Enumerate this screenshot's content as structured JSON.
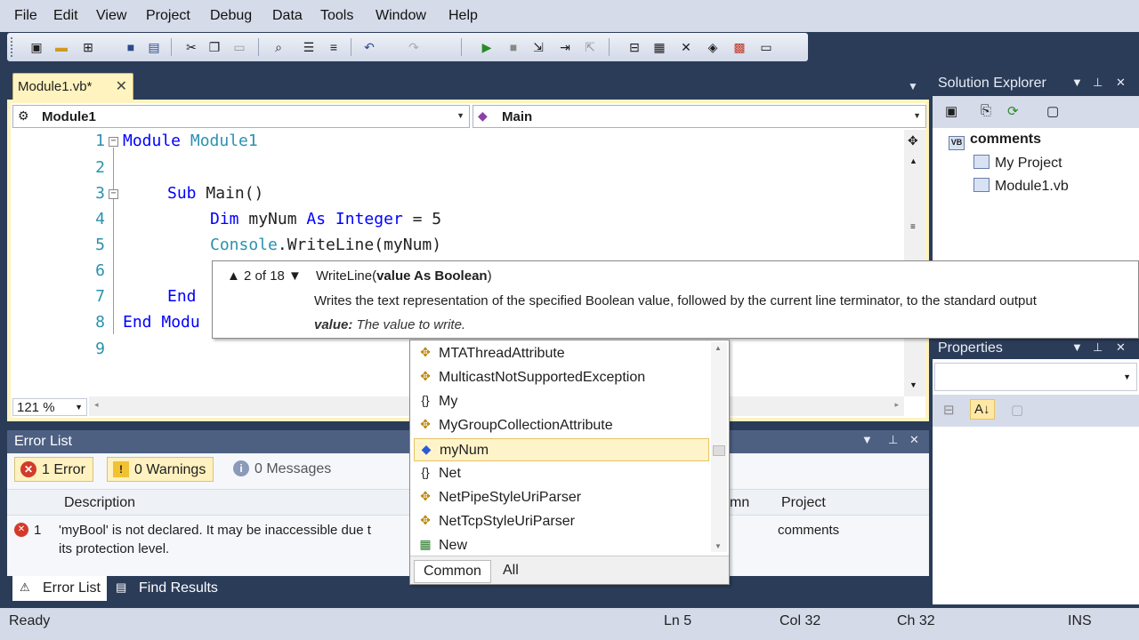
{
  "menu": [
    "File",
    "Edit",
    "View",
    "Project",
    "Debug",
    "Data",
    "Tools",
    "Window",
    "Help"
  ],
  "toolbar": {
    "icons": [
      "new-project-icon",
      "open-file-icon",
      "add-item-icon",
      "save-icon",
      "save-all-icon",
      "cut-icon",
      "copy-icon",
      "paste-icon",
      "find-icon",
      "comment-icon",
      "uncomment-icon",
      "undo-icon",
      "redo-icon",
      "start-debugging-icon",
      "stop-icon",
      "step-into-icon",
      "step-over-icon",
      "step-out-icon",
      "solution-explorer-icon",
      "properties-icon",
      "toolbox-icon",
      "object-browser-icon",
      "start-page-icon",
      "extension-manager-icon"
    ]
  },
  "doc_tab": {
    "label": "Module1.vb*",
    "close": "✕"
  },
  "nav_bar": {
    "left": "Module1",
    "right": "Main"
  },
  "code": {
    "line_numbers": [
      "1",
      "2",
      "3",
      "4",
      "5",
      "6",
      "7",
      "8",
      "9"
    ],
    "l1_kw": "Module",
    "l1_name": "Module1",
    "l3_kw": "Sub",
    "l3_rest": "Main()",
    "l4_kw1": "Dim",
    "l4_var": "myNum",
    "l4_kw2": "As",
    "l4_kw3": "Integer",
    "l4_rest": "= 5",
    "l5_type": "Console",
    "l5_rest": ".WriteLine(myNum)",
    "l7_kw": "End",
    "l8_kw": "End",
    "l8_kw2": "Modu"
  },
  "zoom": "121 %",
  "param_info": {
    "nav": "▲ 2 of 18 ▼",
    "method": "WriteLine(",
    "param": "value As Boolean",
    "close": ")",
    "description": "Writes the text representation of the specified Boolean value, followed by the current line terminator, to the standard output",
    "value_label": "value:",
    "value_desc": "The value to write."
  },
  "intellisense": {
    "items": [
      {
        "label": "MTAThreadAttribute",
        "icon": "class-icon"
      },
      {
        "label": "MulticastNotSupportedException",
        "icon": "class-icon"
      },
      {
        "label": "My",
        "icon": "namespace-icon"
      },
      {
        "label": "MyGroupCollectionAttribute",
        "icon": "class-icon"
      },
      {
        "label": "myNum",
        "icon": "local-variable-icon"
      },
      {
        "label": "Net",
        "icon": "namespace-icon"
      },
      {
        "label": "NetPipeStyleUriParser",
        "icon": "class-icon"
      },
      {
        "label": "NetTcpStyleUriParser",
        "icon": "class-icon"
      },
      {
        "label": "New",
        "icon": "keyword-icon"
      }
    ],
    "selected_index": 4,
    "tabs": [
      "Common",
      "All"
    ]
  },
  "error_list": {
    "title": "Error List",
    "filters": {
      "errors": "1 Error",
      "warnings": "0 Warnings",
      "messages": "0 Messages"
    },
    "columns": {
      "description": "Description",
      "column": "mn",
      "project": "Project"
    },
    "rows": [
      {
        "num": "1",
        "description_line1": "'myBool' is not declared. It may be inaccessible due t",
        "description_line2": "its protection level.",
        "project": "comments"
      }
    ]
  },
  "bottom_tabs": [
    "Error List",
    "Find Results"
  ],
  "solution_explorer": {
    "title": "Solution Explorer",
    "tree": {
      "root": "comments",
      "children": [
        "My Project",
        "Module1.vb"
      ]
    }
  },
  "properties": {
    "title": "Properties"
  },
  "status": {
    "ready": "Ready",
    "ln": "Ln 5",
    "col": "Col 32",
    "ch": "Ch 32",
    "ins": "INS"
  },
  "colors": {
    "keyword": "#0000ff",
    "type": "#2b91af",
    "chrome": "#2b3c59",
    "tab_active": "#fff3bf"
  }
}
